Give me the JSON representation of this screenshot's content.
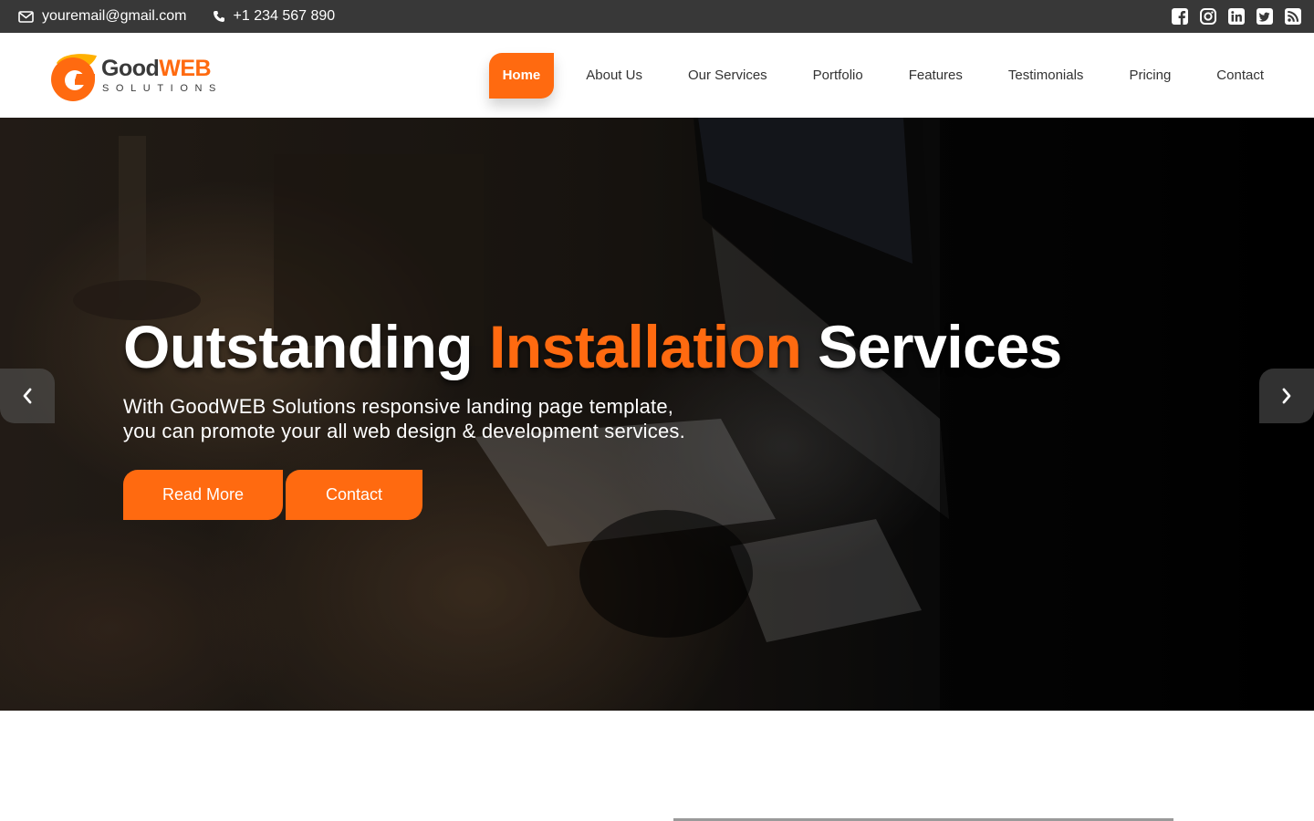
{
  "topbar": {
    "email": "youremail@gmail.com",
    "phone": "+1 234 567 890",
    "email_icon": "envelope-icon",
    "phone_icon": "phone-icon",
    "socials": [
      "facebook-icon",
      "instagram-icon",
      "linkedin-icon",
      "twitter-icon",
      "rss-icon"
    ]
  },
  "logo": {
    "word_part1": "Good",
    "word_part2": "WEB",
    "tagline": "SOLUTIONS"
  },
  "nav": {
    "items": [
      {
        "label": "Home",
        "active": true
      },
      {
        "label": "About Us"
      },
      {
        "label": "Our Services"
      },
      {
        "label": "Portfolio"
      },
      {
        "label": "Features"
      },
      {
        "label": "Testimonials"
      },
      {
        "label": "Pricing"
      },
      {
        "label": "Contact"
      }
    ]
  },
  "hero": {
    "title_part1": "Outstanding ",
    "title_highlight": "Installation",
    "title_part2": " Services",
    "subtitle_line1": "With GoodWEB Solutions responsive landing page template,",
    "subtitle_line2": "you can promote your all web design & development services.",
    "btn_read_more": "Read More",
    "btn_contact": "Contact",
    "prev_icon": "chevron-left-icon",
    "next_icon": "chevron-right-icon"
  },
  "colors": {
    "accent": "#ff6a10",
    "topbar": "#383838",
    "text_dark": "#333333"
  }
}
